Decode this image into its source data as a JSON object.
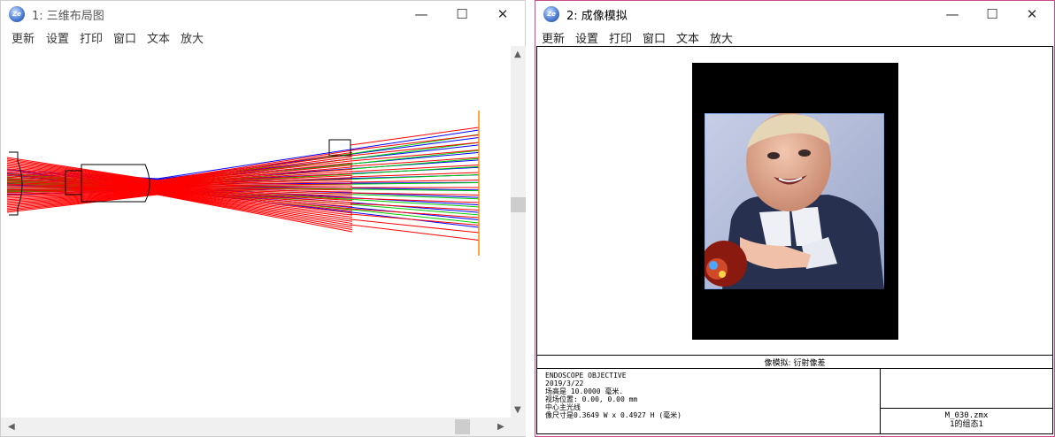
{
  "window1": {
    "title": "1: 三维布局图",
    "icon": "zemax-app-icon",
    "menu": [
      "更新",
      "设置",
      "打印",
      "窗口",
      "文本",
      "放大"
    ],
    "controls": {
      "minimize": "—",
      "maximize": "☐",
      "close": "✕"
    }
  },
  "window2": {
    "title": "2: 成像模拟",
    "icon": "zemax-app-icon",
    "menu": [
      "更新",
      "设置",
      "打印",
      "窗口",
      "文本",
      "放大"
    ],
    "controls": {
      "minimize": "—",
      "maximize": "☐",
      "close": "✕"
    },
    "caption": "像模拟: 衍射像差",
    "info": [
      "ENDOSCOPE OBJECTIVE",
      "2019/3/22",
      "场高是 10.0000 毫米.",
      "视场位置: 0.00, 0.00 mm",
      "中心主光线",
      "像尺寸是0.3649 W x 0.4927 H (毫米)"
    ],
    "file_name": "M_030.zmx",
    "config": "1的组态1"
  },
  "colors": {
    "ray_blue": "#0000ff",
    "ray_green": "#00cc00",
    "ray_red": "#ff0000",
    "image_plane": "#ff8c00",
    "window2_border": "#c84c8c"
  }
}
